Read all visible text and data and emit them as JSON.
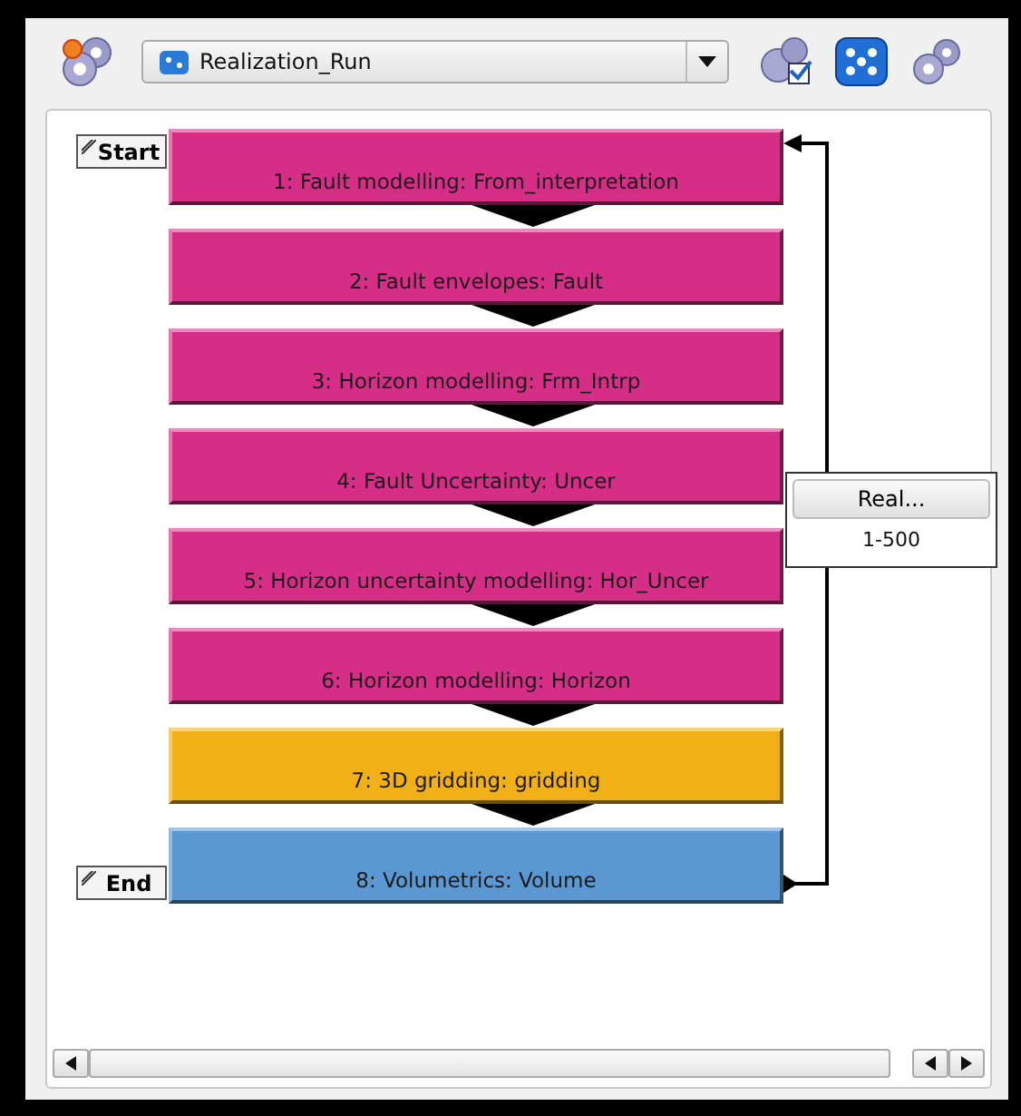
{
  "toolbar": {
    "workflow_dropdown": {
      "value": "Realization_Run"
    }
  },
  "diagram": {
    "start_label": "Start",
    "end_label": "End",
    "steps": [
      {
        "label": "1:  Fault modelling: From_interpretation",
        "color": "#d62e87"
      },
      {
        "label": "2:  Fault envelopes: Fault",
        "color": "#d62e87"
      },
      {
        "label": "3:  Horizon modelling: Frm_Intrp",
        "color": "#d62e87"
      },
      {
        "label": "4:  Fault Uncertainty: Uncer",
        "color": "#d62e87"
      },
      {
        "label": "5:  Horizon uncertainty modelling: Hor_Uncer",
        "color": "#d62e87"
      },
      {
        "label": "6:  Horizon modelling: Horizon",
        "color": "#d62e87"
      },
      {
        "label": "7:  3D gridding: gridding",
        "color": "#f0b016"
      },
      {
        "label": "8:  Volumetrics: Volume",
        "color": "#5b97d0"
      }
    ],
    "loop": {
      "button": "Real...",
      "range": "1-500"
    }
  }
}
